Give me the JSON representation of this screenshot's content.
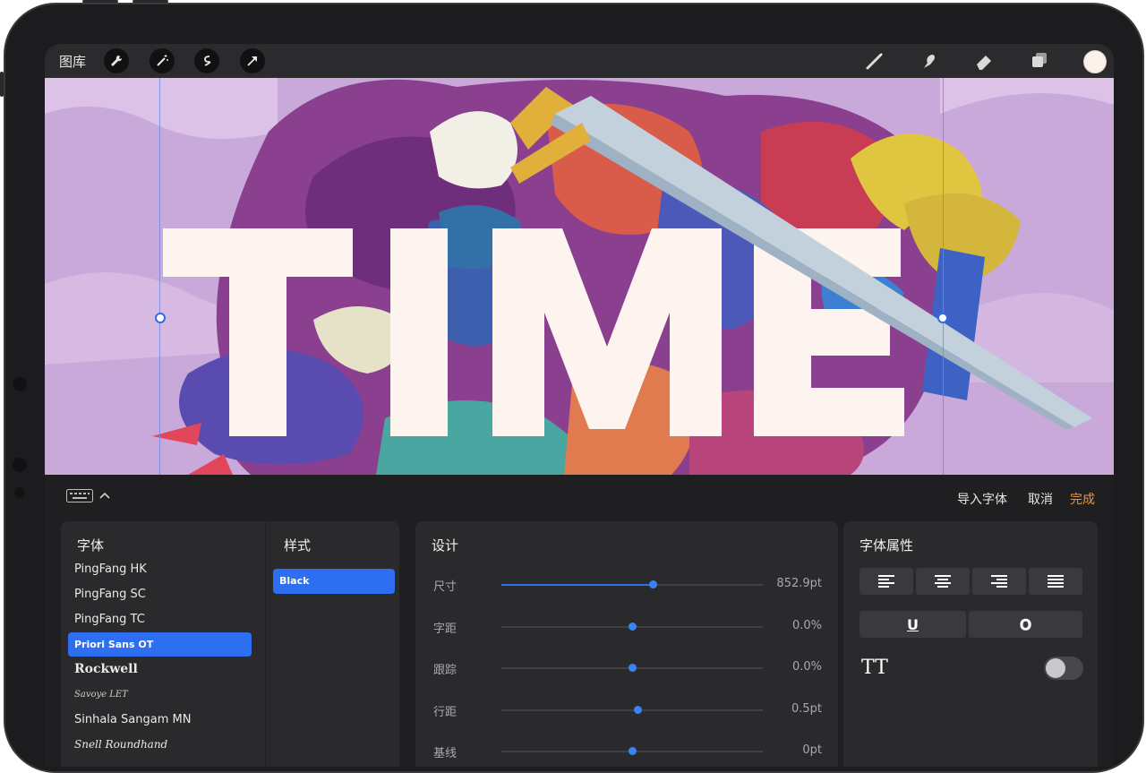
{
  "toolbar": {
    "gallery": "图库",
    "left_tools": [
      "wrench-icon",
      "magic-wand-icon",
      "selection-icon",
      "transform-arrow-icon"
    ],
    "right_tools": [
      "brush-icon",
      "smudge-icon",
      "eraser-icon",
      "layers-icon"
    ],
    "current_color": "#fbf3ea"
  },
  "canvas": {
    "text": "TIME"
  },
  "panel": {
    "import_font": "导入字体",
    "cancel": "取消",
    "done": "完成",
    "fonts": {
      "title": "字体",
      "items": [
        "PingFang HK",
        "PingFang SC",
        "PingFang TC",
        "Priori Sans OT",
        "Rockwell",
        "Savoye LET",
        "Sinhala Sangam MN",
        "Snell Roundhand"
      ],
      "selected": "Priori Sans OT"
    },
    "styles": {
      "title": "样式",
      "items": [
        "Black"
      ]
    },
    "design": {
      "title": "设计",
      "sliders": [
        {
          "label": "尺寸",
          "value": "852.9pt",
          "level": 0.58
        },
        {
          "label": "字距",
          "value": "0.0%",
          "level": 0.5
        },
        {
          "label": "跟踪",
          "value": "0.0%",
          "level": 0.5
        },
        {
          "label": "行距",
          "value": "0.5pt",
          "level": 0.52
        },
        {
          "label": "基线",
          "value": "0pt",
          "level": 0.5
        }
      ]
    },
    "attributes": {
      "title": "字体属性",
      "alignments": [
        "align-left-icon",
        "align-center-icon",
        "align-right-icon",
        "align-justify-icon"
      ],
      "underline": "U",
      "outline": "O",
      "all_caps": "TT",
      "all_caps_on": false
    }
  },
  "colors": {
    "accent": "#2d6ff0",
    "done": "#e69a3b"
  }
}
